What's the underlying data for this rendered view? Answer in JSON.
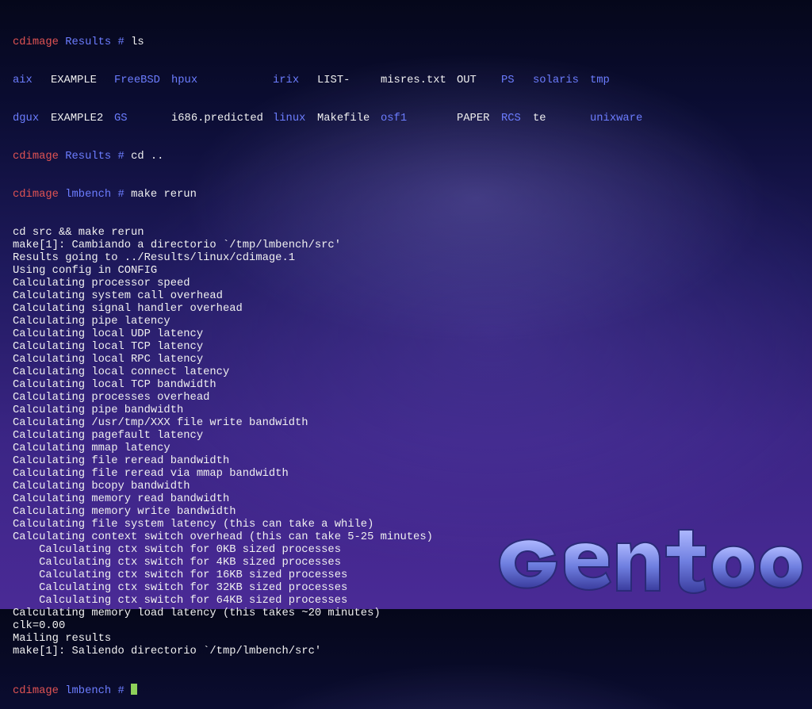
{
  "colors": {
    "hostname": "#e05353",
    "directory": "#6c7dff",
    "text": "#f0f0f0",
    "cursor": "#8ed15a"
  },
  "prompt1": {
    "host": "cdimage",
    "dir": "Results",
    "sym": "#",
    "cmd": "ls"
  },
  "ls_row1": [
    {
      "text": "aix",
      "type": "dir"
    },
    {
      "text": "EXAMPLE",
      "type": "file"
    },
    {
      "text": "FreeBSD",
      "type": "dir"
    },
    {
      "text": "hpux",
      "type": "dir"
    },
    {
      "text": "irix",
      "type": "dir"
    },
    {
      "text": "LIST-",
      "type": "file"
    },
    {
      "text": "misres.txt",
      "type": "file"
    },
    {
      "text": "OUT",
      "type": "file"
    },
    {
      "text": "PS",
      "type": "dir"
    },
    {
      "text": "solaris",
      "type": "dir"
    },
    {
      "text": "tmp",
      "type": "dir"
    }
  ],
  "ls_row2": [
    {
      "text": "dgux",
      "type": "dir"
    },
    {
      "text": "EXAMPLE2",
      "type": "file"
    },
    {
      "text": "GS",
      "type": "dir"
    },
    {
      "text": "i686.predicted",
      "type": "file"
    },
    {
      "text": "linux",
      "type": "dir"
    },
    {
      "text": "Makefile",
      "type": "file"
    },
    {
      "text": "osf1",
      "type": "dir"
    },
    {
      "text": "PAPER",
      "type": "file"
    },
    {
      "text": "RCS",
      "type": "dir"
    },
    {
      "text": "te",
      "type": "file"
    },
    {
      "text": "unixware",
      "type": "dir"
    }
  ],
  "prompt2": {
    "host": "cdimage",
    "dir": "Results",
    "sym": "#",
    "cmd": "cd .."
  },
  "prompt3": {
    "host": "cdimage",
    "dir": "lmbench",
    "sym": "#",
    "cmd": "make rerun"
  },
  "output": [
    "cd src && make rerun",
    "make[1]: Cambiando a directorio `/tmp/lmbench/src'",
    "Results going to ../Results/linux/cdimage.1",
    "Using config in CONFIG",
    "Calculating processor speed",
    "Calculating system call overhead",
    "Calculating signal handler overhead",
    "Calculating pipe latency",
    "Calculating local UDP latency",
    "Calculating local TCP latency",
    "Calculating local RPC latency",
    "Calculating local connect latency",
    "Calculating local TCP bandwidth",
    "Calculating processes overhead",
    "Calculating pipe bandwidth",
    "Calculating /usr/tmp/XXX file write bandwidth",
    "Calculating pagefault latency",
    "Calculating mmap latency",
    "Calculating file reread bandwidth",
    "Calculating file reread via mmap bandwidth",
    "Calculating bcopy bandwidth",
    "Calculating memory read bandwidth",
    "Calculating memory write bandwidth",
    "Calculating file system latency (this can take a while)",
    "Calculating context switch overhead (this can take 5-25 minutes)",
    "    Calculating ctx switch for 0KB sized processes",
    "    Calculating ctx switch for 4KB sized processes",
    "    Calculating ctx switch for 16KB sized processes",
    "    Calculating ctx switch for 32KB sized processes",
    "    Calculating ctx switch for 64KB sized processes",
    "Calculating memory load latency (this takes ~20 minutes)",
    "clk=0.00",
    "Mailing results",
    "make[1]: Saliendo directorio `/tmp/lmbench/src'"
  ],
  "prompt4": {
    "host": "cdimage",
    "dir": "lmbench",
    "sym": "#",
    "cmd": ""
  },
  "logo_text": "GENTOO"
}
